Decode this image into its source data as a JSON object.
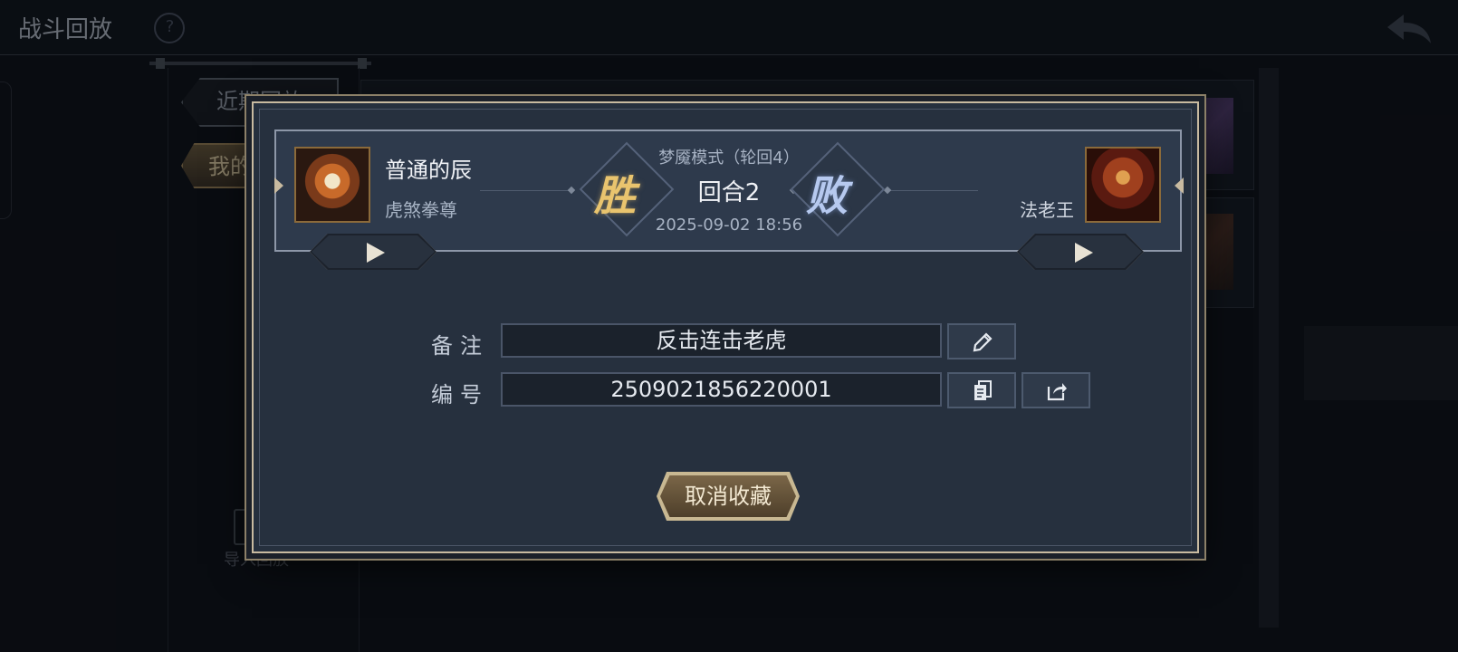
{
  "app": {
    "title": "战斗回放",
    "help_icon": "?"
  },
  "tabs": {
    "recent_label": "近期回放",
    "mine_label": "我的"
  },
  "import": {
    "label": "导入回放"
  },
  "dialog": {
    "left_player": {
      "name": "普通的辰",
      "hero": "虎煞拳尊",
      "result": "胜"
    },
    "right_player": {
      "name": "",
      "hero": "法老王",
      "result": "败"
    },
    "mode": "梦魇模式（轮回4）",
    "round": "回合2",
    "date": "2025-09-02 18:56",
    "note_label": "备注",
    "note_value": "反击连击老虎",
    "id_label": "编号",
    "id_value": "2509021856220001",
    "cancel_label": "取消收藏"
  },
  "colors": {
    "win": "#e9c46e",
    "lose": "#b6c9ef",
    "frame": "#c8baa0",
    "panel": "#26303e"
  },
  "icons": [
    "help-icon",
    "back-arrow-icon",
    "play-icon",
    "pencil-icon",
    "copy-icon",
    "share-icon",
    "import-icon"
  ]
}
